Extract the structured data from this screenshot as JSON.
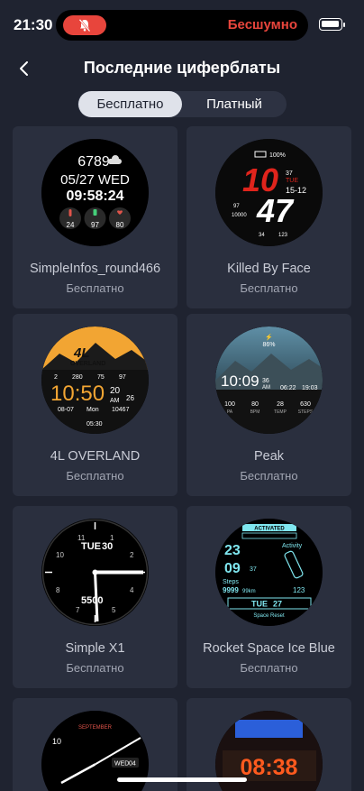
{
  "status": {
    "time": "21:30",
    "mode_text": "Бесшумно"
  },
  "header": {
    "title": "Последние циферблаты"
  },
  "segment": {
    "free_label": "Бесплатно",
    "paid_label": "Платный"
  },
  "faces": [
    {
      "name": "SimpleInfos_round466",
      "price": "Бесплатно",
      "dial": {
        "steps": "6789",
        "date": "05/27 WED",
        "time": "09:58:24",
        "temp": "24",
        "battery": "97",
        "heart": "80"
      }
    },
    {
      "name": "Killed By Face",
      "price": "Бесплатно",
      "dial": {
        "battery": "100%",
        "hour": "10",
        "minute": "47",
        "seconds": "37",
        "dow": "TUE",
        "date": "15-12",
        "heart": "97",
        "steps": "10000",
        "left_small": "34",
        "right_small": "123"
      }
    },
    {
      "name": "4L OVERLAND",
      "price": "Бесплатно",
      "dial": {
        "logo": "4L",
        "logo_sub": "OVERLAND",
        "cell_a": "2",
        "cell_b": "280",
        "cell_c": "75",
        "cell_d": "97",
        "time": "10:50",
        "seconds": "20",
        "ampm": "AM",
        "temp": "26",
        "date": "08-07",
        "dow": "Mon",
        "steps": "10467",
        "sunset": "05:30"
      }
    },
    {
      "name": "Peak",
      "price": "Бесплатно",
      "dial": {
        "battery": "86%",
        "time": "10:09",
        "seconds": "36",
        "ampm": "AM",
        "sunrise": "06:22",
        "sunset": "19:03",
        "pa": "100",
        "pa_label": "PA",
        "bpm": "80",
        "bpm_label": "BPM",
        "temp": "28",
        "temp_label": "TEMP",
        "steps": "630",
        "steps_label": "STEPS"
      }
    },
    {
      "name": "Simple X1",
      "price": "Бесплатно",
      "dial": {
        "dow": "TUE",
        "day": "30",
        "digital": "5500"
      }
    },
    {
      "name": "Rocket Space Ice Blue",
      "price": "Бесплатно",
      "dial": {
        "header": "ACTIVATED",
        "hour": "23",
        "minute": "09",
        "seconds": "37",
        "activity": "Activity",
        "steps_label": "Steps",
        "steps": "9999",
        "km": "99km",
        "heart": "123",
        "dow": "TUE",
        "date": "27",
        "footer": "Space Reset"
      }
    },
    {
      "name": "",
      "price": "",
      "dial": {
        "month": "SEPTEMBER",
        "dow": "WED",
        "day": "04"
      }
    },
    {
      "name": "",
      "price": "",
      "dial": {
        "time": "08:38"
      }
    }
  ]
}
